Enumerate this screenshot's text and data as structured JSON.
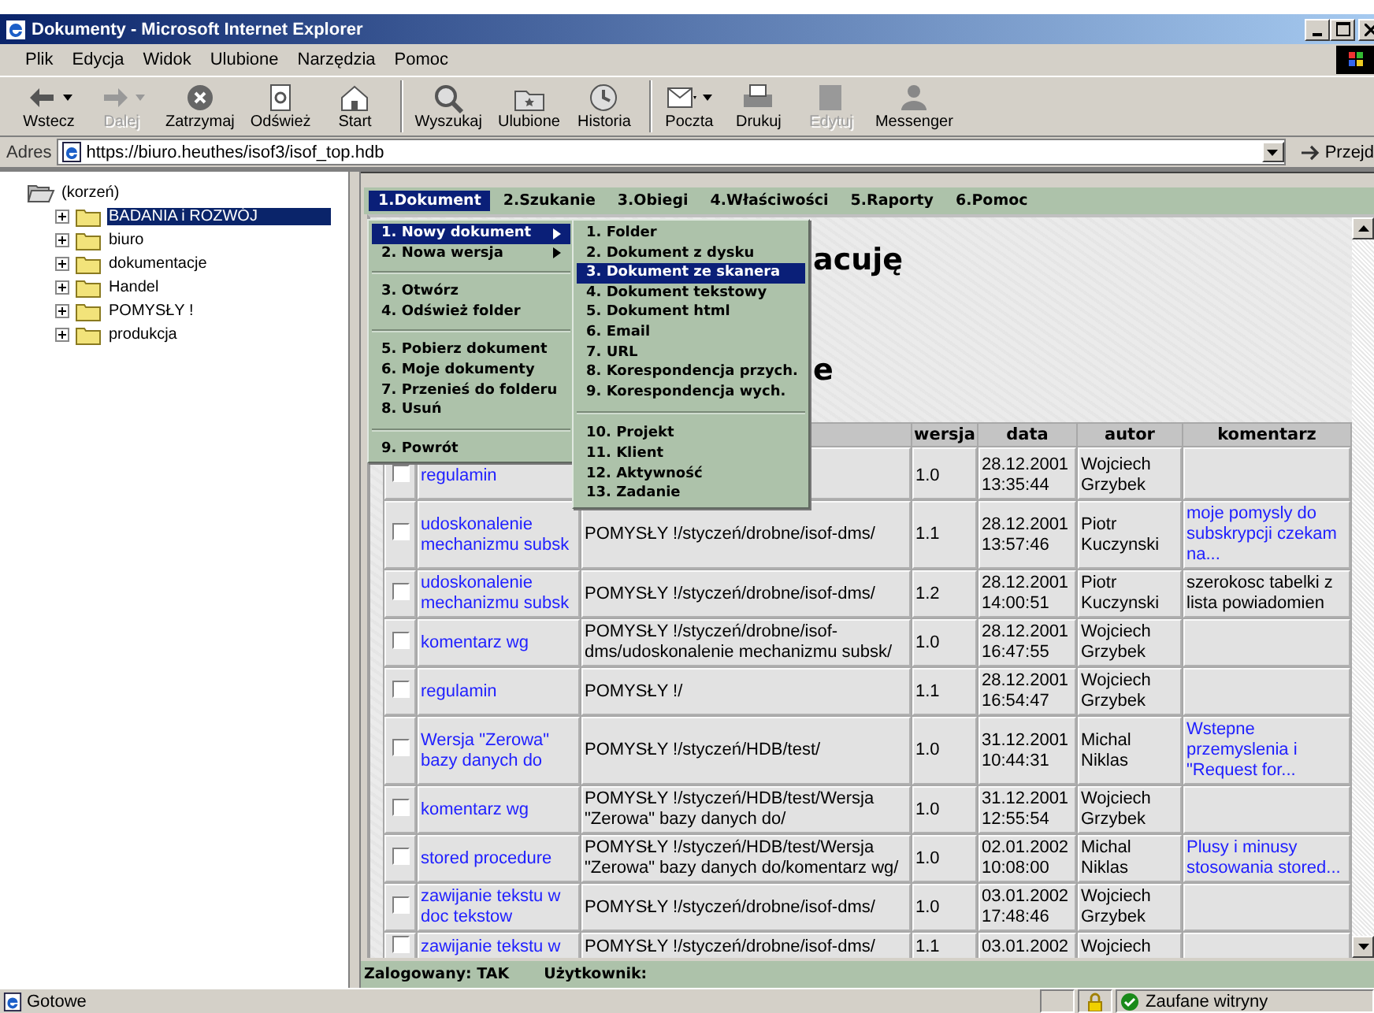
{
  "window": {
    "title": "Dokumenty - Microsoft Internet Explorer"
  },
  "menu_bar": [
    "Plik",
    "Edycja",
    "Widok",
    "Ulubione",
    "Narzędzia",
    "Pomoc"
  ],
  "toolbar": [
    {
      "label": "Wstecz",
      "kind": "back",
      "disabled": false,
      "dropdown": true
    },
    {
      "label": "Dalej",
      "kind": "forward",
      "disabled": true,
      "dropdown": true
    },
    {
      "label": "Zatrzymaj",
      "kind": "stop",
      "disabled": false,
      "dropdown": false
    },
    {
      "label": "Odśwież",
      "kind": "refresh",
      "disabled": false,
      "dropdown": false
    },
    {
      "label": "Start",
      "kind": "home",
      "disabled": false,
      "dropdown": false
    },
    {
      "label": "Wyszukaj",
      "kind": "search",
      "disabled": false,
      "dropdown": false,
      "group_start": true
    },
    {
      "label": "Ulubione",
      "kind": "favorites",
      "disabled": false,
      "dropdown": false
    },
    {
      "label": "Historia",
      "kind": "history",
      "disabled": false,
      "dropdown": false
    },
    {
      "label": "Poczta",
      "kind": "mail",
      "disabled": false,
      "dropdown": true,
      "group_start": true
    },
    {
      "label": "Drukuj",
      "kind": "print",
      "disabled": false,
      "dropdown": false
    },
    {
      "label": "Edytuj",
      "kind": "edit",
      "disabled": true,
      "dropdown": false
    },
    {
      "label": "Messenger",
      "kind": "messenger",
      "disabled": false,
      "dropdown": false
    }
  ],
  "address_bar": {
    "label": "Adres",
    "value": "https://biuro.heuthes/isof3/isof_top.hdb",
    "go": "Przejd"
  },
  "tree": {
    "label": "(korzeń)",
    "children": [
      {
        "label": "BADANIA i ROZWÓJ",
        "selected": true,
        "expanded": false
      },
      {
        "label": "biuro",
        "selected": false,
        "expanded": false
      },
      {
        "label": "dokumentacje",
        "selected": false,
        "expanded": false
      },
      {
        "label": "Handel",
        "selected": false,
        "expanded": false
      },
      {
        "label": "POMYSŁY !",
        "selected": false,
        "expanded": false
      },
      {
        "label": "produkcja",
        "selected": false,
        "expanded": false
      }
    ]
  },
  "nav": [
    {
      "label": "1.Dokument",
      "selected": true
    },
    {
      "label": "2.Szukanie",
      "selected": false
    },
    {
      "label": "3.Obiegi",
      "selected": false
    },
    {
      "label": "4.Właściwości",
      "selected": false
    },
    {
      "label": "5.Raporty",
      "selected": false
    },
    {
      "label": "6.Pomoc",
      "selected": false
    }
  ],
  "dropdown_menu": [
    [
      {
        "label": "1. Nowy dokument",
        "submenu": true,
        "selected": true
      },
      {
        "label": "2. Nowa wersja",
        "submenu": true,
        "selected": false
      }
    ],
    [
      {
        "label": "3. Otwórz",
        "submenu": false,
        "selected": false
      },
      {
        "label": "4. Odśwież folder",
        "submenu": false,
        "selected": false
      }
    ],
    [
      {
        "label": "5. Pobierz dokument",
        "submenu": false,
        "selected": false
      },
      {
        "label": "6. Moje dokumenty",
        "submenu": false,
        "selected": false
      },
      {
        "label": "7. Przenieś do folderu",
        "submenu": false,
        "selected": false
      },
      {
        "label": "8. Usuń",
        "submenu": false,
        "selected": false
      }
    ],
    [
      {
        "label": "9. Powrót",
        "submenu": false,
        "selected": false
      }
    ]
  ],
  "submenu": [
    [
      {
        "label": "1. Folder",
        "selected": false
      },
      {
        "label": "2. Dokument z dysku",
        "selected": false
      },
      {
        "label": "3. Dokument ze skanera",
        "selected": true
      },
      {
        "label": "4. Dokument tekstowy",
        "selected": false
      },
      {
        "label": "5. Dokument html",
        "selected": false
      },
      {
        "label": "6. Email",
        "selected": false
      },
      {
        "label": "7. URL",
        "selected": false
      },
      {
        "label": "8. Korespondencja przych.",
        "selected": false
      },
      {
        "label": "9. Korespondencja wych.",
        "selected": false
      }
    ],
    [
      {
        "label": "10. Projekt",
        "selected": false
      },
      {
        "label": "11. Klient",
        "selected": false
      },
      {
        "label": "12. Aktywność",
        "selected": false
      },
      {
        "label": "13. Zadanie",
        "selected": false
      }
    ]
  ],
  "headings": [
    "acuję",
    "e"
  ],
  "table": {
    "columns": [
      "wersja",
      "data",
      "autor",
      "komentarz"
    ],
    "rows": [
      {
        "checked": false,
        "name": "regulamin",
        "version": "1.0",
        "date": "28.12.2001 13:35:44",
        "author": "Wojciech Grzybek"
      },
      {
        "checked": false,
        "name": "udoskonalenie mechanizmu subsk",
        "path": "POMYSŁY !/styczeń/drobne/isof-dms/",
        "version": "1.1",
        "date": "28.12.2001 13:57:46",
        "author": "Piotr Kuczynski",
        "comment": "moje pomysly do subskrypcji czekam na...",
        "comment_link": true
      },
      {
        "checked": false,
        "name": "udoskonalenie mechanizmu subsk",
        "path": "POMYSŁY !/styczeń/drobne/isof-dms/",
        "version": "1.2",
        "date": "28.12.2001 14:00:51",
        "author": "Piotr Kuczynski",
        "comment": "szerokosc tabelki z lista powiadomien",
        "comment_link": false
      },
      {
        "checked": false,
        "name": "komentarz wg",
        "path": "POMYSŁY !/styczeń/drobne/isof-dms/udoskonalenie mechanizmu subsk/",
        "version": "1.0",
        "date": "28.12.2001 16:47:55",
        "author": "Wojciech Grzybek"
      },
      {
        "checked": false,
        "name": "regulamin",
        "path": "POMYSŁY !/",
        "version": "1.1",
        "date": "28.12.2001 16:54:47",
        "author": "Wojciech Grzybek"
      },
      {
        "checked": false,
        "name": "Wersja \"Zerowa\" bazy danych do",
        "path": "POMYSŁY !/styczeń/HDB/test/",
        "version": "1.0",
        "date": "31.12.2001 10:44:31",
        "author": "Michal Niklas",
        "comment": "Wstepne przemyslenia i \"Request for...",
        "comment_link": true
      },
      {
        "checked": false,
        "name": "komentarz wg",
        "path": "POMYSŁY !/styczeń/HDB/test/Wersja \"Zerowa\" bazy danych do/",
        "version": "1.0",
        "date": "31.12.2001 12:55:54",
        "author": "Wojciech Grzybek"
      },
      {
        "checked": false,
        "name": "stored procedure",
        "path": "POMYSŁY !/styczeń/HDB/test/Wersja \"Zerowa\" bazy danych do/komentarz wg/",
        "version": "1.0",
        "date": "02.01.2002 10:08:00",
        "author": "Michal Niklas",
        "comment": "Plusy i minusy stosowania stored...",
        "comment_link": true
      },
      {
        "checked": false,
        "name": "zawijanie tekstu w doc tekstow",
        "path": "POMYSŁY !/styczeń/drobne/isof-dms/",
        "version": "1.0",
        "date": "03.01.2002 17:48:46",
        "author": "Wojciech Grzybek"
      },
      {
        "checked": false,
        "name": "zawijanie tekstu w",
        "path": "POMYSŁY !/styczeń/drobne/isof-dms/",
        "version": "1.1",
        "date": "03.01.2002",
        "author": "Wojciech"
      }
    ]
  },
  "frame_status": [
    {
      "label": "Zalogowany: TAK"
    },
    {
      "label": "Użytkownik:"
    }
  ],
  "status_bar": {
    "text": "Gotowe",
    "zone": "Zaufane witryny"
  }
}
